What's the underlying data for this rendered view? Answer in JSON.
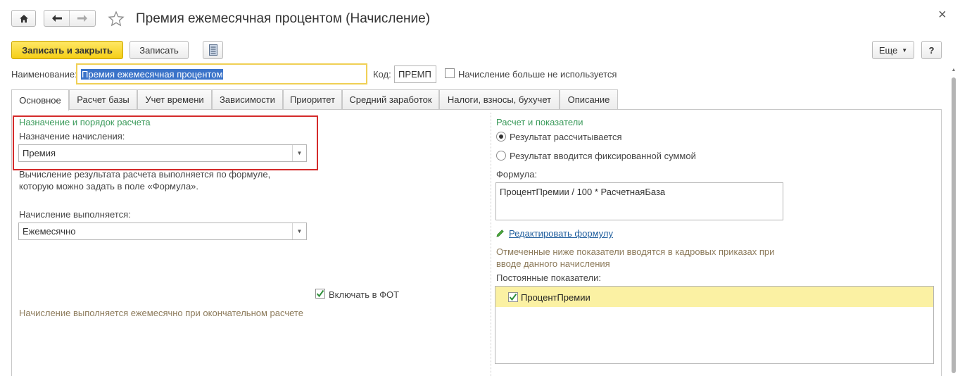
{
  "window": {
    "title": "Премия ежемесячная процентом (Начисление)",
    "close_glyph": "×"
  },
  "toolbar": {
    "save_close_label": "Записать и закрыть",
    "save_label": "Записать",
    "more_label": "Еще",
    "help_label": "?"
  },
  "header_fields": {
    "name_label": "Наименование:",
    "name_value": "Премия ежемесячная процентом",
    "code_label": "Код:",
    "code_value": "ПРЕМП",
    "unused_label": "Начисление больше не используется"
  },
  "tabs": [
    {
      "label": "Основное"
    },
    {
      "label": "Расчет базы"
    },
    {
      "label": "Учет времени"
    },
    {
      "label": "Зависимости"
    },
    {
      "label": "Приоритет"
    },
    {
      "label": "Средний заработок"
    },
    {
      "label": "Налоги, взносы, бухучет"
    },
    {
      "label": "Описание"
    }
  ],
  "left": {
    "section_title": "Назначение и порядок расчета",
    "purpose_label": "Назначение начисления:",
    "purpose_value": "Премия",
    "calc_note_1": "Вычисление результата расчета выполняется по формуле,",
    "calc_note_2": "которую можно задать в поле «Формула».",
    "period_label": "Начисление выполняется:",
    "period_value": "Ежемесячно",
    "fot_label": "Включать в ФОТ",
    "footer_note": "Начисление выполняется ежемесячно при окончательном расчете"
  },
  "right": {
    "section_title": "Расчет и показатели",
    "radio_calculated": "Результат рассчитывается",
    "radio_fixed": "Результат вводится фиксированной суммой",
    "formula_label": "Формула:",
    "formula_value": "ПроцентПремии / 100 * РасчетнаяБаза",
    "edit_formula_link": "Редактировать формулу",
    "indicators_note_1": "Отмеченные ниже показатели вводятся в кадровых приказах при",
    "indicators_note_2": "вводе данного начисления",
    "constant_label": "Постоянные показатели:",
    "indicators": [
      {
        "name": "ПроцентПремии",
        "checked": true
      }
    ]
  },
  "colors": {
    "accent_yellow": "#f5ce16",
    "section_green": "#3a9a5a",
    "note_brown": "#8c7a5a",
    "highlight_red": "#d42b2b",
    "link_blue": "#1f5d9c",
    "selected_row": "#fbf1a3"
  }
}
